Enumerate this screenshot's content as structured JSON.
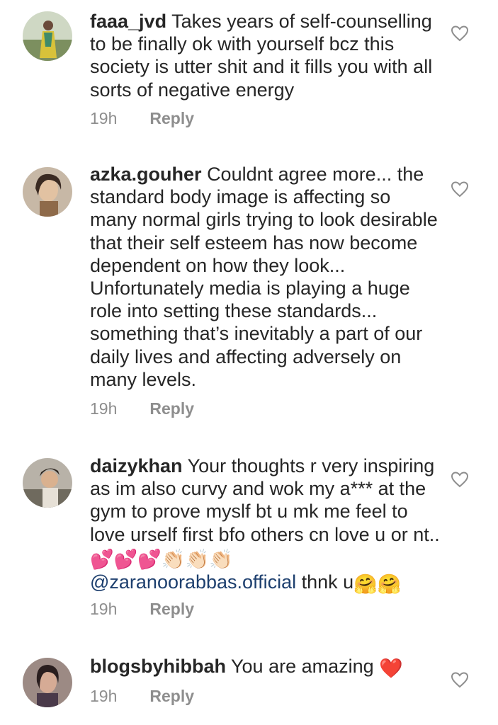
{
  "comments": [
    {
      "username": "faaa_jvd",
      "text": "Takes years of self-counselling to be finally ok with yourself bcz this society is utter shit and it fills you with all sorts of negative energy",
      "time": "19h",
      "reply_label": "Reply"
    },
    {
      "username": "azka.gouher",
      "text": "Couldnt agree more... the standard body image is affecting so many normal girls trying to look desirable that their self esteem has now become dependent on how they look... Unfortunately media is playing a huge role into setting these standards... something that’s inevitably a part of our daily lives and affecting adversely on many levels.",
      "time": "19h",
      "reply_label": "Reply"
    },
    {
      "username": "daizykhan",
      "text": "Your thoughts r very inspiring as im also curvy and wok my a*** at the gym to prove myslf bt u mk me feel to love urself first bfo others cn love u or nt..",
      "emojis_1": "💕💕💕👏🏻👏🏻👏🏻",
      "mention": "@zaranoorabbas.official",
      "text_after": "thnk u",
      "emojis_2": "🤗🤗",
      "time": "19h",
      "reply_label": "Reply"
    },
    {
      "username": "blogsbyhibbah",
      "text": "You are amazing",
      "emoji": "❤️",
      "time": "19h",
      "reply_label": "Reply"
    }
  ],
  "colors": {
    "text": "#262626",
    "meta": "#8e8e8e",
    "mention": "#1d3f6e",
    "heart_emoji": "#e0102a"
  }
}
